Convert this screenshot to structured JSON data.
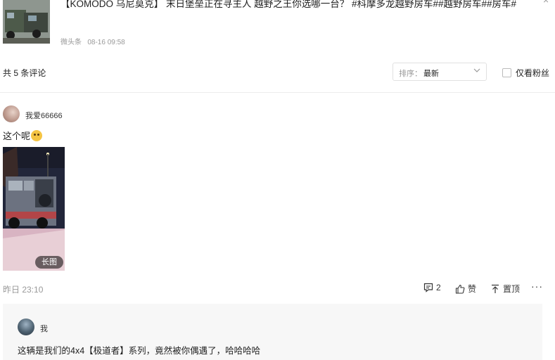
{
  "post": {
    "title": "【KOMODO 乌尼莫克】 末日堡垒正在寻主人 越野之王你选哪一台？ #科摩多龙越野房车##越野房车##房车#",
    "source": "微头条",
    "date": "08-16 09:58"
  },
  "comments_header": {
    "count_label": "共 5 条评论",
    "sort_label": "排序：",
    "sort_value": "最新",
    "fans_only_label": "仅看粉丝"
  },
  "comment": {
    "username": "我爱66666",
    "text": "这个呢",
    "image_badge": "长图",
    "time": "昨日 23:10",
    "reply_count": "2",
    "like_label": "赞",
    "pin_label": "置顶",
    "more_label": "···"
  },
  "reply": {
    "username": "我",
    "text": "这辆是我们的4x4【极道者】系列，竟然被你偶遇了，哈哈哈哈"
  },
  "icons": {
    "close": "close-icon",
    "chevron": "chevron-down-icon",
    "reply": "comment-icon",
    "like": "thumbs-up-icon",
    "pin": "pin-top-icon",
    "emoji": "thinking-face-emoji"
  }
}
